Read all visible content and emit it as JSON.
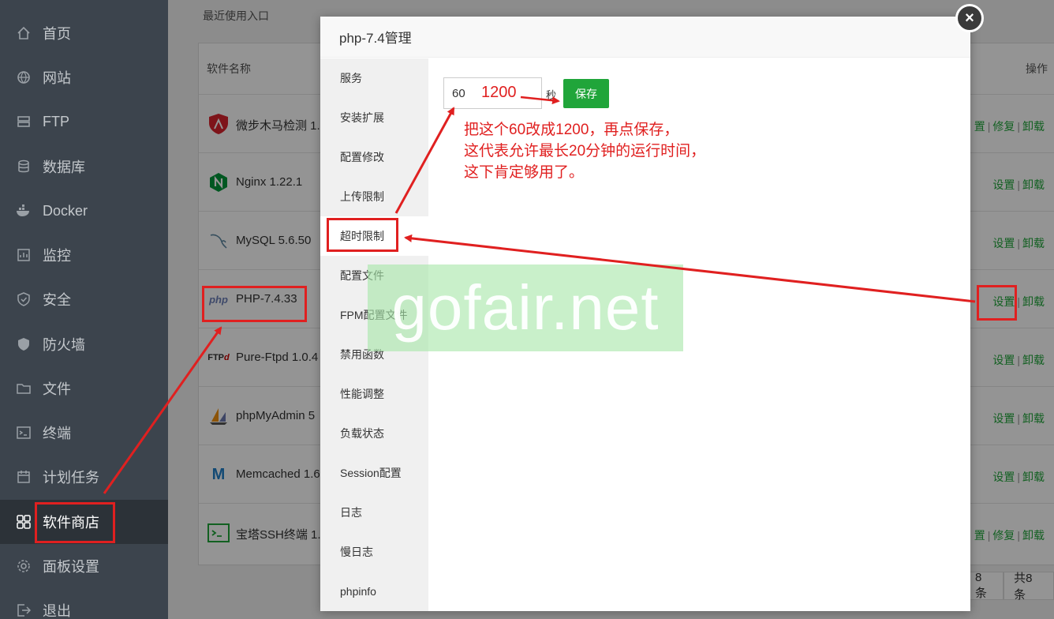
{
  "sidebar": {
    "items": [
      {
        "label": "首页",
        "icon": "home-icon"
      },
      {
        "label": "网站",
        "icon": "globe-icon"
      },
      {
        "label": "FTP",
        "icon": "ftp-icon"
      },
      {
        "label": "数据库",
        "icon": "database-icon"
      },
      {
        "label": "Docker",
        "icon": "docker-icon"
      },
      {
        "label": "监控",
        "icon": "monitor-icon"
      },
      {
        "label": "安全",
        "icon": "shield-icon"
      },
      {
        "label": "防火墙",
        "icon": "firewall-icon"
      },
      {
        "label": "文件",
        "icon": "folder-icon"
      },
      {
        "label": "终端",
        "icon": "terminal-icon"
      },
      {
        "label": "计划任务",
        "icon": "calendar-icon"
      },
      {
        "label": "软件商店",
        "icon": "grid-icon",
        "active": true
      },
      {
        "label": "面板设置",
        "icon": "gear-icon"
      },
      {
        "label": "退出",
        "icon": "logout-icon"
      }
    ]
  },
  "main": {
    "recent_label": "最近使用入口",
    "table": {
      "col_name": "软件名称",
      "col_ops": "操作",
      "rows": [
        {
          "name": "微步木马检测 1.",
          "icon": "shield-logo-icon",
          "ops": [
            "置",
            "修复",
            "卸载"
          ]
        },
        {
          "name": "Nginx 1.22.1",
          "icon": "nginx-icon",
          "ops": [
            "设置",
            "卸载"
          ]
        },
        {
          "name": "MySQL 5.6.50",
          "icon": "mysql-icon",
          "ops": [
            "设置",
            "卸载"
          ]
        },
        {
          "name": "PHP-7.4.33",
          "icon": "php-icon",
          "ops": [
            "设置",
            "卸载"
          ]
        },
        {
          "name": "Pure-Ftpd 1.0.4",
          "icon": "ftpd-icon",
          "ops": [
            "设置",
            "卸载"
          ]
        },
        {
          "name": "phpMyAdmin 5",
          "icon": "phpmyadmin-icon",
          "ops": [
            "设置",
            "卸载"
          ]
        },
        {
          "name": "Memcached 1.6",
          "icon": "memcached-icon",
          "ops": [
            "设置",
            "卸载"
          ]
        },
        {
          "name": "宝塔SSH终端 1.",
          "icon": "ssh-terminal-icon",
          "ops": [
            "置",
            "修复",
            "卸载"
          ]
        }
      ]
    },
    "pager": {
      "per_page": "8条",
      "total": "共8条"
    }
  },
  "dialog": {
    "title": "php-7.4管理",
    "close": "×",
    "menu": [
      "服务",
      "安装扩展",
      "配置修改",
      "上传限制",
      "超时限制",
      "配置文件",
      "FPM配置文件",
      "禁用函数",
      "性能调整",
      "负载状态",
      "Session配置",
      "日志",
      "慢日志",
      "phpinfo"
    ],
    "active_menu": "超时限制",
    "timeout": {
      "value": "60",
      "unit": "秒",
      "save_label": "保存"
    }
  },
  "annotations": {
    "new_value": "1200",
    "instruction_lines": [
      "把这个60改成1200，再点保存，",
      "这代表允许最长20分钟的运行时间，",
      "这下肯定够用了。"
    ],
    "color": "#e02020"
  },
  "watermark": "gofair.net",
  "colors": {
    "accent_green": "#20a53a",
    "sidebar_bg": "#3c444d"
  }
}
